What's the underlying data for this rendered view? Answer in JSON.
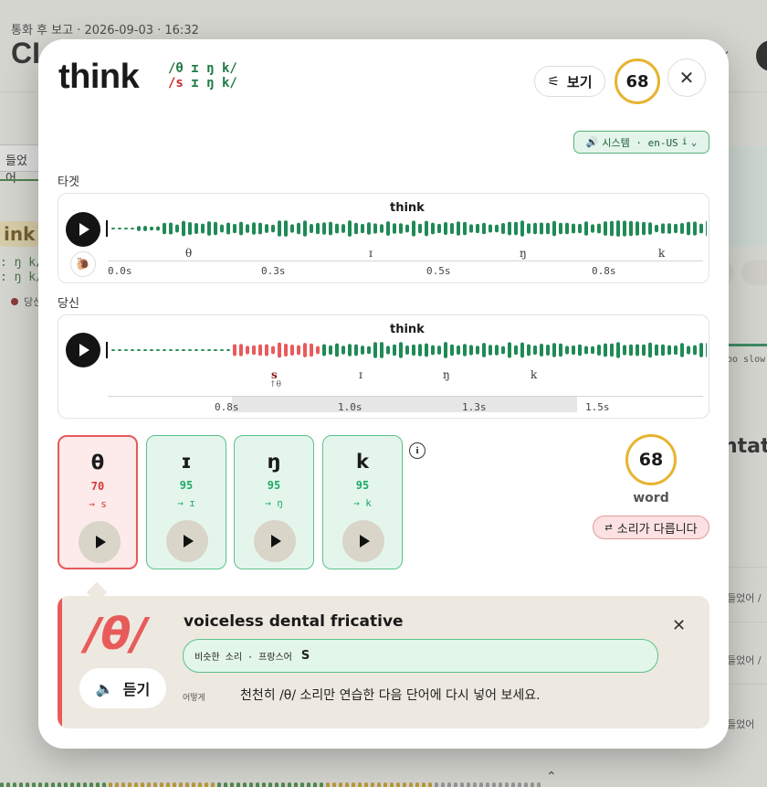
{
  "background": {
    "header": "통화 후 보고 · 2026-09-03 · 16:32",
    "title": "CI",
    "tab_label": "들었어",
    "word_chip": "ink",
    "ipa_lines": [
      ": ŋ k/",
      ": ŋ k/"
    ],
    "legend": "당신",
    "slow_label": "oo slow",
    "heading_fragment": "ntati",
    "rows": [
      "들었어 /",
      "들었어 /",
      "들었어"
    ]
  },
  "modal": {
    "word": "think",
    "ipa_target": "/θ ɪ ŋ k/",
    "ipa_you_bad": "/s",
    "ipa_you_rest": " ɪ ŋ k/",
    "view_button": "보기",
    "score": "68",
    "voice_chip": {
      "text": "시스템 · en-US",
      "info": "i"
    },
    "target_section": {
      "label": "타겟",
      "word": "think",
      "phonemes": [
        "θ",
        "ɪ",
        "ŋ",
        "k"
      ],
      "ticks": [
        "0.0s",
        "0.3s",
        "0.5s",
        "0.8s"
      ]
    },
    "you_section": {
      "label": "당신",
      "word": "think",
      "phonemes": [
        "s",
        "ɪ",
        "ŋ",
        "k"
      ],
      "sub_note": "↑θ",
      "ticks": [
        "0.8s",
        "1.0s",
        "1.3s",
        "1.5s"
      ]
    },
    "phoneme_cards": [
      {
        "symbol": "θ",
        "score": "70",
        "heard": "→ s",
        "status": "bad"
      },
      {
        "symbol": "ɪ",
        "score": "95",
        "heard": "→ ɪ",
        "status": "good"
      },
      {
        "symbol": "ŋ",
        "score": "95",
        "heard": "→ ŋ",
        "status": "good"
      },
      {
        "symbol": "k",
        "score": "95",
        "heard": "→ k",
        "status": "good"
      }
    ],
    "word_score": {
      "value": "68",
      "label": "word"
    },
    "diff_pill": "소리가 다릅니다",
    "detail": {
      "symbol": "/θ/",
      "listen": "듣기",
      "name": "voiceless dental fricative",
      "similar_label": "비슷한 소리 · 프랑스어",
      "similar_value": "S",
      "how_label": "어떻게",
      "tip": "천천히 /θ/ 소리만 연습한 다음 단어에 다시 넣어 보세요."
    },
    "colors": {
      "good": "#1f8a55",
      "bad": "#e85b5b",
      "score_ring": "#e7b431"
    }
  }
}
